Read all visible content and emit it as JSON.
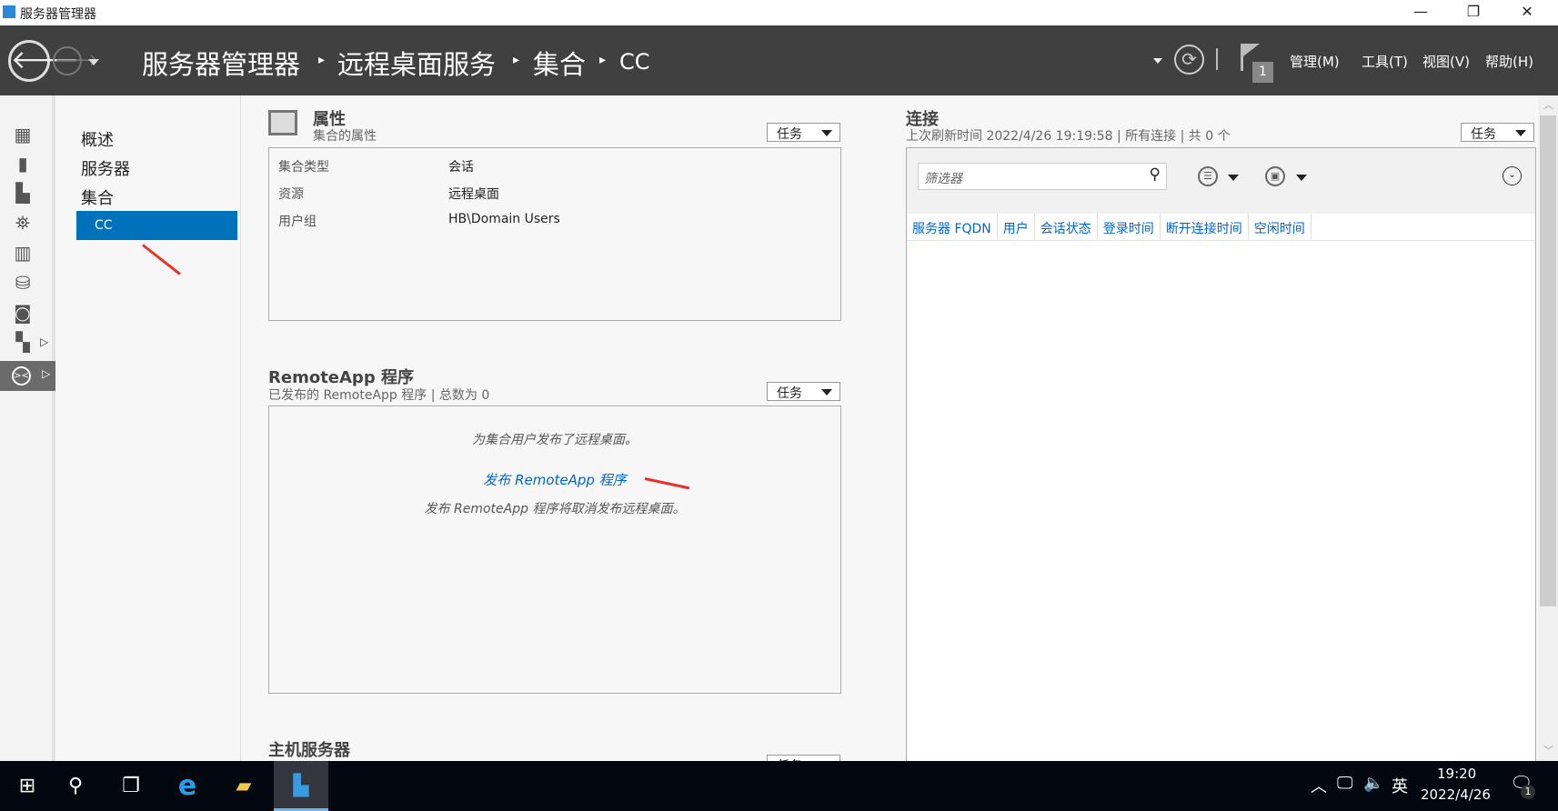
{
  "window": {
    "title": "服务器管理器",
    "min": "—",
    "max": "❐",
    "close": "✕"
  },
  "header": {
    "breadcrumbs": [
      "服务器管理器",
      "远程桌面服务",
      "集合",
      "CC"
    ],
    "notification_count": "1",
    "menus": [
      "管理(M)",
      "工具(T)",
      "视图(V)",
      "帮助(H)"
    ]
  },
  "nav": {
    "items": [
      "概述",
      "服务器",
      "集合"
    ],
    "selected": "CC"
  },
  "properties": {
    "title": "属性",
    "subtitle": "集合的属性",
    "task_label": "任务",
    "rows": [
      {
        "key": "集合类型",
        "value": "会话"
      },
      {
        "key": "资源",
        "value": "远程桌面"
      },
      {
        "key": "用户组",
        "value": "HB\\Domain Users"
      }
    ]
  },
  "remoteapp": {
    "title": "RemoteApp 程序",
    "subtitle": "已发布的 RemoteApp 程序 | 总数为 0",
    "task_label": "任务",
    "message": "为集合用户发布了远程桌面。",
    "link": "发布 RemoteApp 程序",
    "note": "发布 RemoteApp 程序将取消发布远程桌面。"
  },
  "host": {
    "title": "主机服务器",
    "task_label": "任务"
  },
  "connections": {
    "title": "连接",
    "subtitle": "上次刷新时间 2022/4/26 19:19:58 | 所有连接 | 共 0 个",
    "task_label": "任务",
    "filter_placeholder": "筛选器",
    "columns": [
      "服务器 FQDN",
      "用户",
      "会话状态",
      "登录时间",
      "断开连接时间",
      "空闲时间"
    ]
  },
  "taskbar": {
    "time": "19:20",
    "date": "2022/4/26",
    "ime": "英",
    "notif_count": "1"
  }
}
